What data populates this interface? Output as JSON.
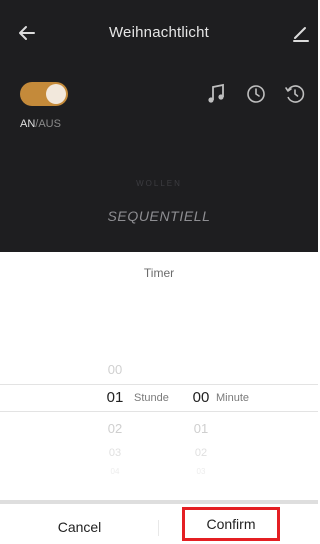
{
  "header": {
    "title": "Weihnachtlicht"
  },
  "controls": {
    "on_label": "AN",
    "slash": "/",
    "off_label": "AUS",
    "toggle_state": "on"
  },
  "mode": {
    "faint_label": "WOLLEN",
    "current": "SEQUENTIELL"
  },
  "timer": {
    "title": "Timer",
    "hour_unit": "Stunde",
    "minute_unit": "Minute",
    "hours": [
      "00",
      "01",
      "02",
      "03",
      "04"
    ],
    "minutes": [
      "00",
      "01",
      "02",
      "03"
    ],
    "selected_hour": "01",
    "selected_minute": "00"
  },
  "actions": {
    "cancel": "Cancel",
    "confirm": "Confirm"
  },
  "colors": {
    "accent": "#c48a3a",
    "highlight": "#e41f23"
  },
  "icons": [
    "back-arrow-icon",
    "edit-icon",
    "music-icon",
    "clock-icon",
    "schedule-icon"
  ]
}
